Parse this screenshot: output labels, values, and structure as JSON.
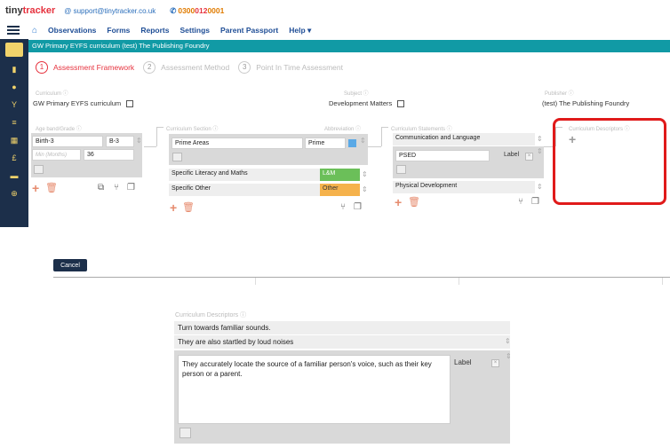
{
  "header": {
    "logo_part1": "tiny",
    "logo_part2": "tracker",
    "email": "@ support@tinytracker.co.uk",
    "phone_a": "0300",
    "phone_b": " 012 ",
    "phone_c": "0001"
  },
  "nav": {
    "items": [
      "Observations",
      "Forms",
      "Reports",
      "Settings",
      "Parent Passport",
      "Help ▾"
    ]
  },
  "title_bar": "GW Primary EYFS curriculum (test) The Publishing Foundry",
  "steps": [
    {
      "num": "1",
      "label": "Assessment Framework"
    },
    {
      "num": "2",
      "label": "Assessment Method"
    },
    {
      "num": "3",
      "label": "Point In Time Assessment"
    }
  ],
  "fields": {
    "curriculum_label": "Curriculum ⓘ",
    "curriculum_value": "GW Primary EYFS curriculum",
    "subject_label": "Subject ⓘ",
    "subject_value": "Development Matters",
    "publisher_label": "Publisher ⓘ",
    "publisher_value": "(test) The Publishing Foundry"
  },
  "age_band": {
    "label": "Age band/Grade ⓘ",
    "name": "Birth-3",
    "code": "B-3",
    "min_placeholder": "Min (Months)",
    "max_value": "36"
  },
  "section": {
    "label": "Curriculum Section ⓘ",
    "abbr_label": "Abbreviation ⓘ",
    "main_name": "Prime Areas",
    "main_abbr": "Prime",
    "items": [
      {
        "name": "Specific Literacy and Maths",
        "abbr": "L&M"
      },
      {
        "name": "Specific Other",
        "abbr": "Other"
      }
    ]
  },
  "statements": {
    "label": "Curriculum Statements ⓘ",
    "items": [
      "Communication and Language",
      "Physical Development"
    ],
    "edit_value": "PSED",
    "edit_label": "Label"
  },
  "descriptors": {
    "label": "Curriculum Descriptors ⓘ",
    "items": [
      "Turn towards familiar sounds.",
      "They are also startled by loud noises"
    ],
    "edit_value": "They accurately locate the source of a familiar person's voice, such as their key person or a parent.",
    "edit_label": "Label"
  },
  "cancel_label": "Cancel",
  "colors": {
    "teal": "#119aa5",
    "navy": "#1c2f4a",
    "red": "#e6323e",
    "highlight": "#e01a1a"
  }
}
